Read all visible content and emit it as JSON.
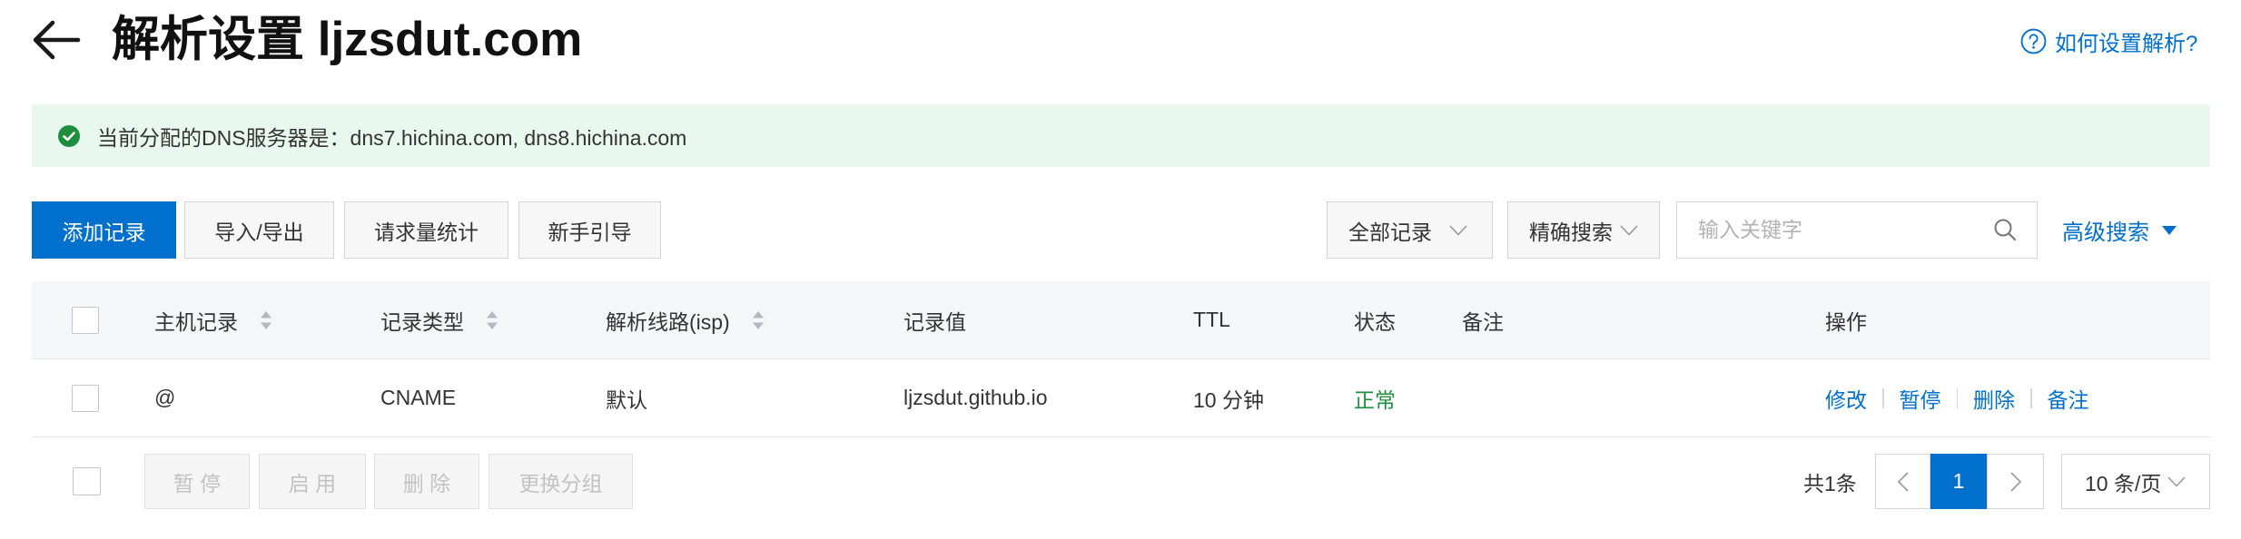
{
  "colors": {
    "primary": "#0070cc",
    "success": "#1e8e3e",
    "alert_bg": "#e9f8ee",
    "header_bg": "#f5f6f8"
  },
  "header": {
    "back_icon": "arrow-left-icon",
    "title": "解析设置 ljzsdut.com",
    "help_icon": "question-circle-icon",
    "help_link": "如何设置解析?"
  },
  "alert": {
    "icon": "check-circle-icon",
    "text": "当前分配的DNS服务器是：dns7.hichina.com, dns8.hichina.com"
  },
  "toolbar": {
    "add_record": "添加记录",
    "import_export": "导入/导出",
    "request_stats": "请求量统计",
    "guide": "新手引导",
    "record_filter": {
      "value": "全部记录",
      "icon": "chevron-down-icon"
    },
    "search_mode": {
      "value": "精确搜索",
      "icon": "chevron-down-icon"
    },
    "search": {
      "placeholder": "输入关键字",
      "value": "",
      "icon": "search-icon"
    },
    "advanced_search": {
      "label": "高级搜索",
      "icon": "caret-down-icon"
    }
  },
  "table": {
    "select_all": false,
    "columns": [
      {
        "label": "主机记录",
        "sortable": true
      },
      {
        "label": "记录类型",
        "sortable": true
      },
      {
        "label": "解析线路(isp)",
        "sortable": true
      },
      {
        "label": "记录值",
        "sortable": false
      },
      {
        "label": "TTL",
        "sortable": false
      },
      {
        "label": "状态",
        "sortable": false
      },
      {
        "label": "备注",
        "sortable": false
      },
      {
        "label": "操作",
        "sortable": false
      }
    ],
    "rows": [
      {
        "selected": false,
        "host": "@",
        "type": "CNAME",
        "line": "默认",
        "value": "ljzsdut.github.io",
        "ttl": "10 分钟",
        "status": "正常",
        "remark": "",
        "actions": [
          "修改",
          "暂停",
          "删除",
          "备注"
        ]
      }
    ]
  },
  "footer": {
    "select_all": false,
    "batch_actions": [
      "暂 停",
      "启 用",
      "删 除",
      "更换分组"
    ],
    "total": "共1条",
    "pagination": {
      "prev_icon": "chevron-left-icon",
      "current_page": "1",
      "next_icon": "chevron-right-icon"
    },
    "page_size": "10 条/页"
  }
}
